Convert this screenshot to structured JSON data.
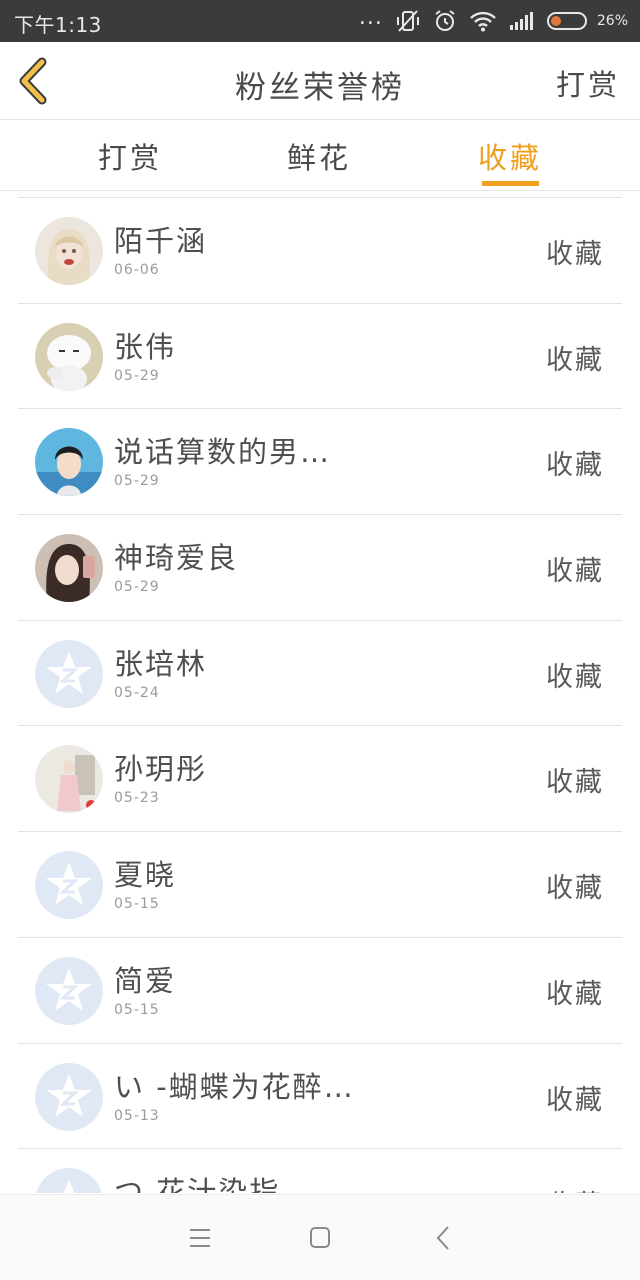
{
  "status_bar": {
    "time": "下午1:13",
    "more": "...",
    "battery": "26%"
  },
  "header": {
    "title": "粉丝荣誉榜",
    "action": "打赏"
  },
  "tabs": [
    {
      "label": "打赏",
      "active": false
    },
    {
      "label": "鲜花",
      "active": false
    },
    {
      "label": "收藏",
      "active": true
    }
  ],
  "colors": {
    "accent": "#f0a01e",
    "status_bar": "#3b3b3b",
    "default_avatar": "#dfe8f4"
  },
  "list": [
    {
      "name": "陌千涵",
      "date": "06-06",
      "type": "收藏",
      "avatar": "photo-girl-blonde"
    },
    {
      "name": "张伟",
      "date": "05-29",
      "type": "收藏",
      "avatar": "photo-cartoon-rabbit"
    },
    {
      "name": "说话算数的男人…",
      "date": "05-29",
      "type": "收藏",
      "avatar": "photo-anime-boy"
    },
    {
      "name": "神琦爱良",
      "date": "05-29",
      "type": "收藏",
      "avatar": "photo-girl-selfie"
    },
    {
      "name": "张培林",
      "date": "05-24",
      "type": "收藏",
      "avatar": "default-qzone-star"
    },
    {
      "name": "孙玥彤",
      "date": "05-23",
      "type": "收藏",
      "avatar": "photo-girl-standing"
    },
    {
      "name": "夏晓",
      "date": "05-15",
      "type": "收藏",
      "avatar": "default-qzone-star"
    },
    {
      "name": "简爱",
      "date": "05-15",
      "type": "收藏",
      "avatar": "default-qzone-star"
    },
    {
      "name": "い -蝴蝶为花醉 、",
      "date": "05-13",
      "type": "收藏",
      "avatar": "default-qzone-star"
    },
    {
      "name": "つ 花汁染指",
      "date": "",
      "type": "收藏",
      "avatar": "default-qzone-star"
    }
  ]
}
